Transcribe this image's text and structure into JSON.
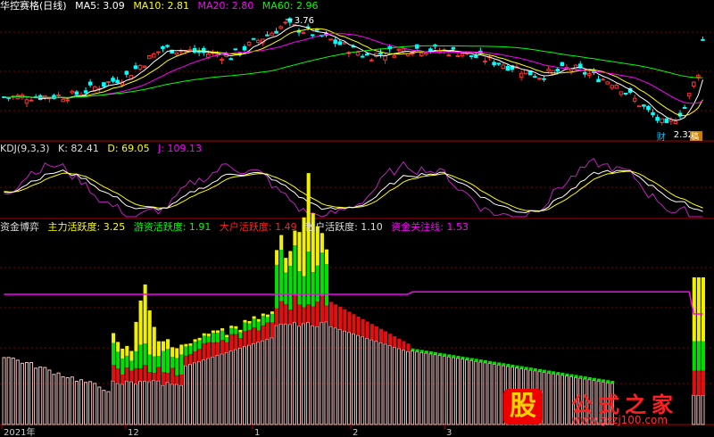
{
  "panels": {
    "price": {
      "title": "华控赛格(日线)",
      "ma": [
        {
          "label": "MA5: 3.09",
          "color": "#ffffff"
        },
        {
          "label": "MA10: 2.81",
          "color": "#ffff00"
        },
        {
          "label": "MA20: 2.80",
          "color": "#ff00ff"
        },
        {
          "label": "MA60: 2.96",
          "color": "#00ff00"
        }
      ],
      "high_label": "3.76",
      "low_label": "2.32",
      "marker_cai": "财",
      "marker_xin": "稿"
    },
    "kdj": {
      "title": "KDJ(9,3,3)",
      "k": "K: 82.41",
      "d": "D: 69.05",
      "j": "J: 109.13"
    },
    "funds": {
      "title": "资金博弈",
      "items": [
        {
          "label": "主力活跃度: 3.25",
          "color": "#ffff00"
        },
        {
          "label": "游资活跃度: 1.91",
          "color": "#00ff00"
        },
        {
          "label": "大户活跃度: 1.49",
          "color": "#ff2020"
        },
        {
          "label": "散户活跃度: 1.10",
          "color": "#dddddd"
        },
        {
          "label": "资金关注线: 1.53",
          "color": "#ff00ff"
        }
      ]
    }
  },
  "x_axis": {
    "labels": [
      "2021年",
      "12",
      "1",
      "2",
      "3"
    ]
  },
  "watermark": {
    "badge": "股",
    "brand": "公式之家",
    "url": "www.gszj100.com"
  },
  "colors": {
    "up": "#ff3030",
    "down": "#00ffff",
    "grid": "#7a0000",
    "axis": "#b00000"
  },
  "chart_data": [
    {
      "type": "line",
      "title": "华控赛格(日线)",
      "series": [
        {
          "name": "MA5",
          "latest": 3.09
        },
        {
          "name": "MA10",
          "latest": 2.81
        },
        {
          "name": "MA20",
          "latest": 2.8
        },
        {
          "name": "MA60",
          "latest": 2.96
        }
      ],
      "annotations": [
        {
          "text": "3.76",
          "kind": "high"
        },
        {
          "text": "2.32",
          "kind": "low"
        }
      ]
    },
    {
      "type": "line",
      "title": "KDJ(9,3,3)",
      "series": [
        {
          "name": "K",
          "latest": 82.41
        },
        {
          "name": "D",
          "latest": 69.05
        },
        {
          "name": "J",
          "latest": 109.13
        }
      ]
    },
    {
      "type": "bar",
      "title": "资金博弈",
      "series": [
        {
          "name": "主力活跃度",
          "latest": 3.25
        },
        {
          "name": "游资活跃度",
          "latest": 1.91
        },
        {
          "name": "大户活跃度",
          "latest": 1.49
        },
        {
          "name": "散户活跃度",
          "latest": 1.1
        },
        {
          "name": "资金关注线",
          "latest": 1.53
        }
      ]
    }
  ]
}
